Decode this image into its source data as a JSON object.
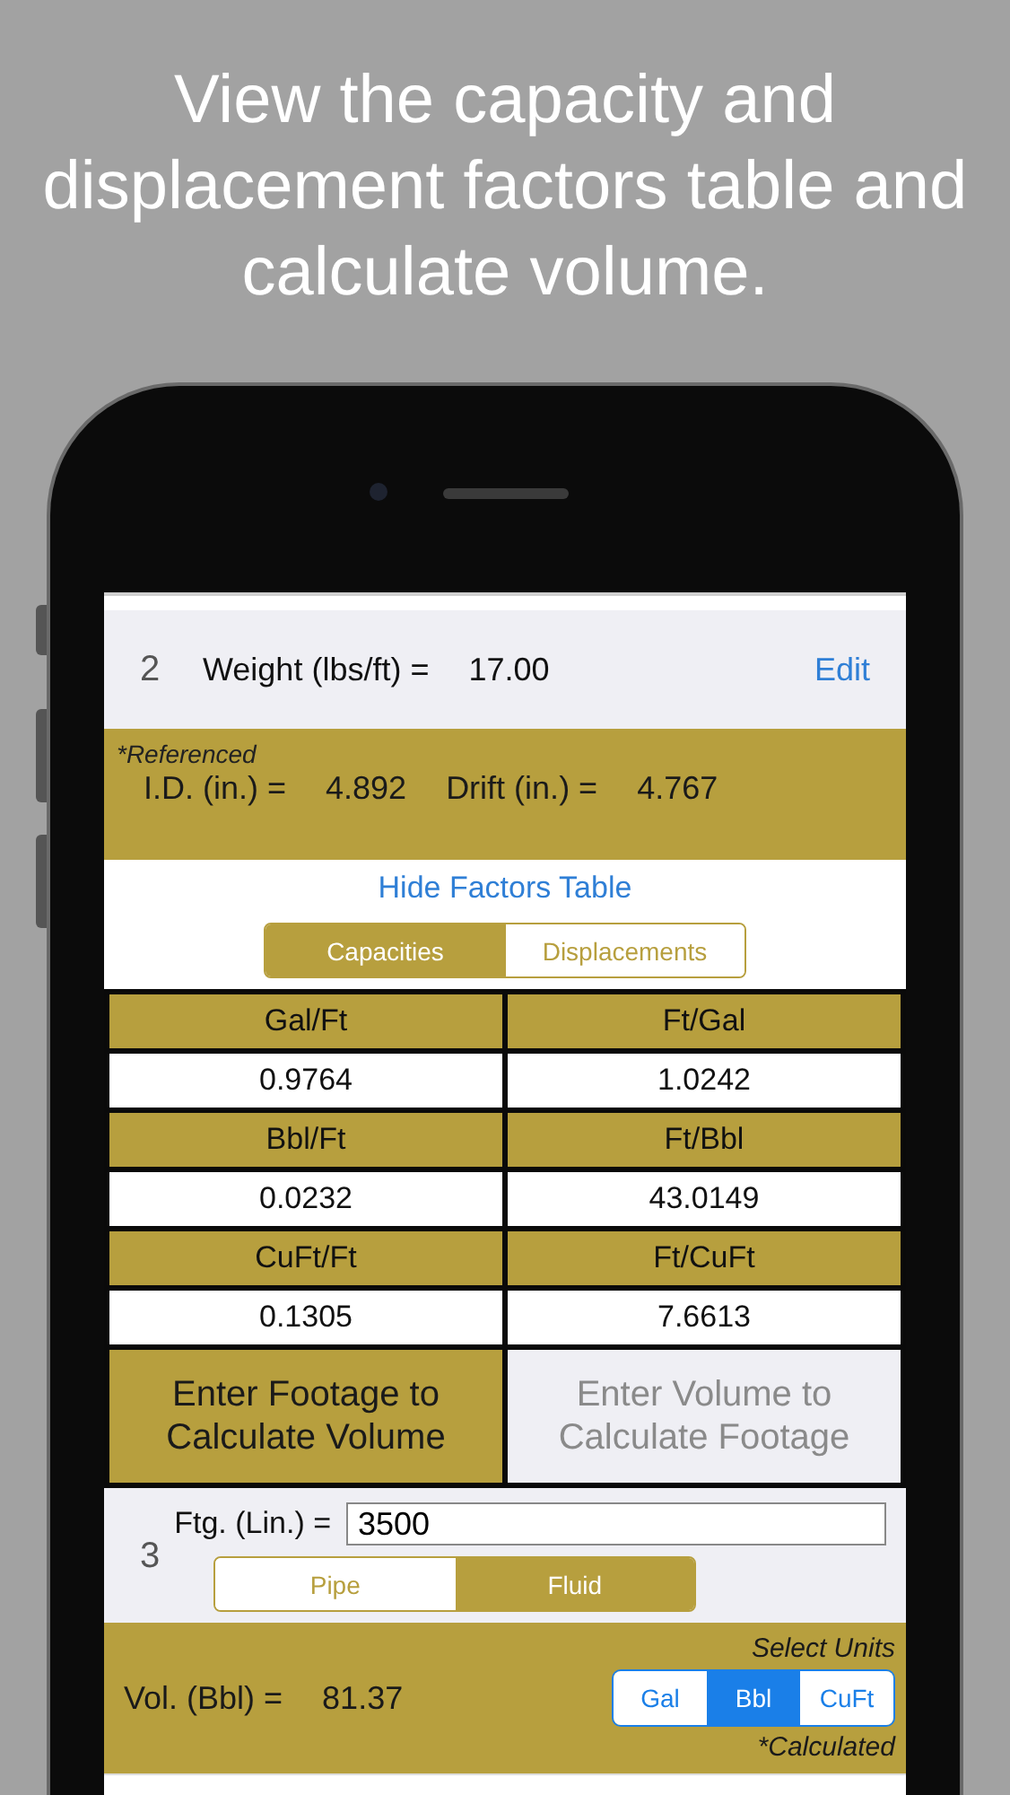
{
  "headline": "View the capacity and displacement factors table and calculate volume.",
  "weight_row": {
    "index": "2",
    "label": "Weight (lbs/ft) =",
    "value": "17.00",
    "action": "Edit"
  },
  "referenced": {
    "note": "*Referenced",
    "fields": [
      {
        "label": "I.D. (in.) =",
        "value": "4.892"
      },
      {
        "label": "Drift (in.) =",
        "value": "4.767"
      }
    ]
  },
  "factors_link": "Hide Factors Table",
  "factor_tabs": [
    {
      "label": "Capacities",
      "selected": true
    },
    {
      "label": "Displacements",
      "selected": false
    }
  ],
  "factors_table": [
    [
      {
        "header": "Gal/Ft",
        "value": "0.9764"
      },
      {
        "header": "Ft/Gal",
        "value": "1.0242"
      }
    ],
    [
      {
        "header": "Bbl/Ft",
        "value": "0.0232"
      },
      {
        "header": "Ft/Bbl",
        "value": "43.0149"
      }
    ],
    [
      {
        "header": "CuFt/Ft",
        "value": "0.1305"
      },
      {
        "header": "Ft/CuFt",
        "value": "7.6613"
      }
    ]
  ],
  "mode_toggle": [
    {
      "label": "Enter Footage to Calculate Volume",
      "selected": true
    },
    {
      "label": "Enter Volume to Calculate Footage",
      "selected": false
    }
  ],
  "footage": {
    "index": "3",
    "label": "Ftg. (Lin.) =",
    "value": "3500",
    "options": [
      {
        "label": "Pipe",
        "selected": false
      },
      {
        "label": "Fluid",
        "selected": true
      }
    ]
  },
  "volume": {
    "label": "Vol. (Bbl) =",
    "value": "81.37",
    "units_caption": "Select Units",
    "units": [
      {
        "label": "Gal",
        "selected": false
      },
      {
        "label": "Bbl",
        "selected": true
      },
      {
        "label": "CuFt",
        "selected": false
      }
    ],
    "note": "*Calculated"
  }
}
